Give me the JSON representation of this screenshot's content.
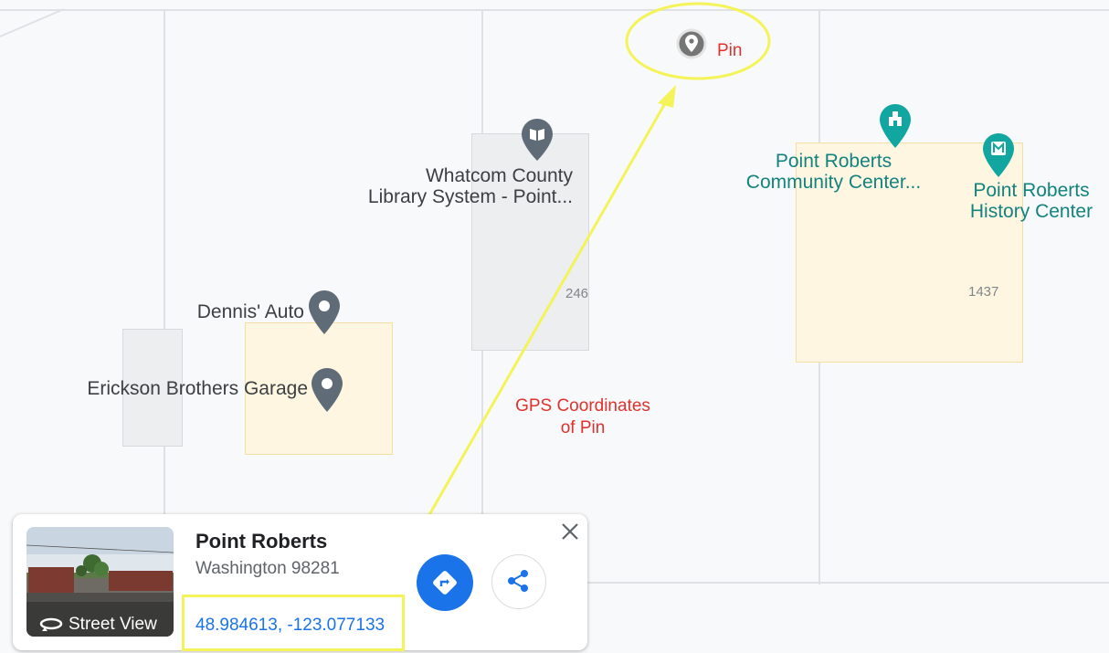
{
  "map": {
    "annotations": {
      "pin_label": "Pin",
      "gps_label_line1": "GPS Coordinates",
      "gps_label_line2": "of Pin"
    },
    "places": {
      "library_line1": "Whatcom County",
      "library_line2": "Library System -  Point...",
      "community_line1": "Point Roberts",
      "community_line2": "Community Center...",
      "history_line1": "Point Roberts",
      "history_line2": "History Center",
      "dennis": "Dennis' Auto",
      "erickson": "Erickson Brothers Garage"
    },
    "address_numbers": {
      "n246": "246",
      "n1437": "1437"
    },
    "icons": {
      "pin": "dropped-pin-icon",
      "library": "library-book-icon",
      "community": "community-center-icon",
      "history": "museum-icon",
      "poi": "place-marker-icon"
    },
    "colors": {
      "highlight": "#f4f45a",
      "annotation_red": "#e0312d",
      "teal": "#12837e",
      "poi_gray": "#5f6c78",
      "link_blue": "#1a73e8"
    }
  },
  "card": {
    "street_view_label": "Street View",
    "title": "Point Roberts",
    "address": "Washington 98281",
    "coordinates": "48.984613, -123.077133"
  }
}
